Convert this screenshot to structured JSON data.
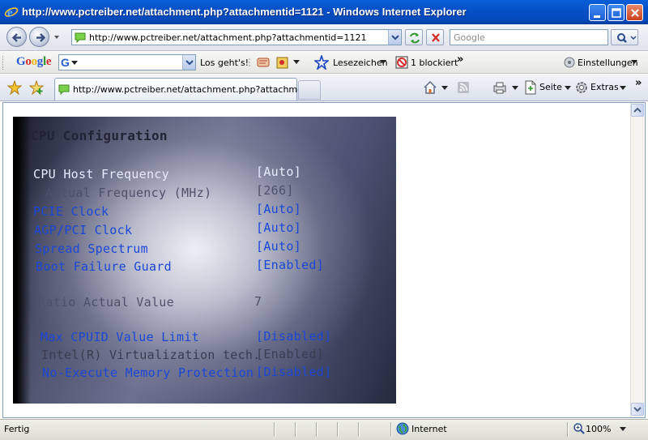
{
  "window": {
    "title": "http://www.pctreiber.net/attachment.php?attachmentid=1121 - Windows Internet Explorer"
  },
  "navigation": {
    "address": "http://www.pctreiber.net/attachment.php?attachmentid=1121",
    "search_placeholder": "Google"
  },
  "google_toolbar": {
    "logo": "Google",
    "search_icon_letter": "G",
    "go_label": "Los geht's!",
    "bookmarks_label": "Lesezeichen",
    "popups_label": "1 blockiert",
    "more_label": "»",
    "settings_label": "Einstellungen"
  },
  "tabs": [
    {
      "label": "http://www.pctreiber.net/attachment.php?attachme..."
    }
  ],
  "commandbar": {
    "page_label": "Seite",
    "tools_label": "Extras",
    "more_label": "»"
  },
  "bios": {
    "title": "CPU Configuration",
    "rows": [
      {
        "label": "CPU Host Frequency",
        "value": "[Auto]"
      },
      {
        "label": "Actual Frequency (MHz)",
        "value": "[266]"
      },
      {
        "label": "PCIE Clock",
        "value": "[Auto]"
      },
      {
        "label": "AGP/PCI Clock",
        "value": "[Auto]"
      },
      {
        "label": "Spread Spectrum",
        "value": "[Auto]"
      },
      {
        "label": "Boot Failure Guard",
        "value": "[Enabled]"
      },
      {
        "label": "Ratio Actual Value",
        "value": "7"
      },
      {
        "label": "Max CPUID Value Limit",
        "value": "[Disabled]"
      },
      {
        "label": "Intel(R) Virtualization tech.",
        "value": "[Enabled]"
      },
      {
        "label": "No-Execute Memory Protection",
        "value": "[Disabled]"
      }
    ]
  },
  "statusbar": {
    "status": "Fertig",
    "zone": "Internet",
    "zoom": "100%"
  },
  "colors": {
    "titlebar": "#0550c8",
    "bios_blue": "#1c47d6"
  }
}
